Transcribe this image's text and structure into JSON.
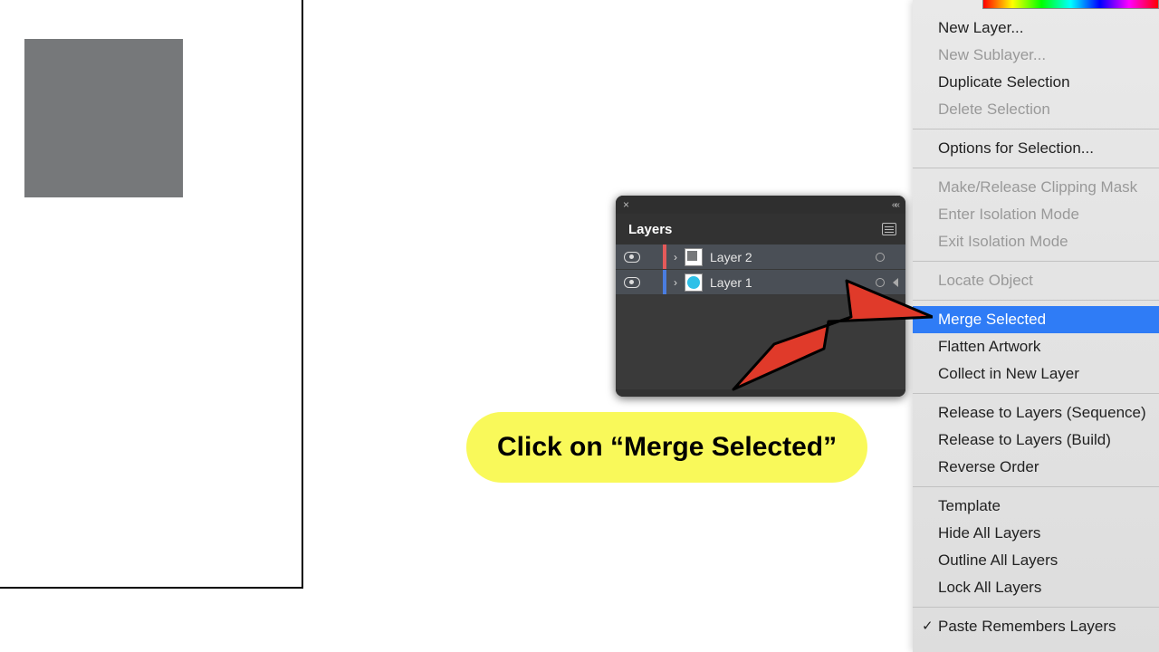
{
  "layers_panel": {
    "title": "Layers",
    "rows": [
      {
        "name": "Layer 2",
        "color": "red"
      },
      {
        "name": "Layer 1",
        "color": "blue"
      }
    ]
  },
  "context_menu": {
    "items": [
      {
        "label": "New Layer...",
        "disabled": false
      },
      {
        "label": "New Sublayer...",
        "disabled": true
      },
      {
        "label": "Duplicate Selection",
        "disabled": false
      },
      {
        "label": "Delete Selection",
        "disabled": true
      }
    ],
    "options_for_selection": "Options for Selection...",
    "clip_group": [
      {
        "label": "Make/Release Clipping Mask",
        "disabled": true
      },
      {
        "label": "Enter Isolation Mode",
        "disabled": true
      },
      {
        "label": "Exit Isolation Mode",
        "disabled": true
      }
    ],
    "locate_object": "Locate Object",
    "structure_group": [
      {
        "label": "Merge Selected",
        "highlight": true
      },
      {
        "label": "Flatten Artwork"
      },
      {
        "label": "Collect in New Layer"
      }
    ],
    "release_group": [
      {
        "label": "Release to Layers (Sequence)"
      },
      {
        "label": "Release to Layers (Build)"
      },
      {
        "label": "Reverse Order"
      }
    ],
    "view_group": [
      {
        "label": "Template"
      },
      {
        "label": "Hide All Layers"
      },
      {
        "label": "Outline All Layers"
      },
      {
        "label": "Lock All Layers"
      }
    ],
    "paste_remembers": "Paste Remembers Layers"
  },
  "callout": {
    "text": "Click on “Merge Selected”"
  }
}
